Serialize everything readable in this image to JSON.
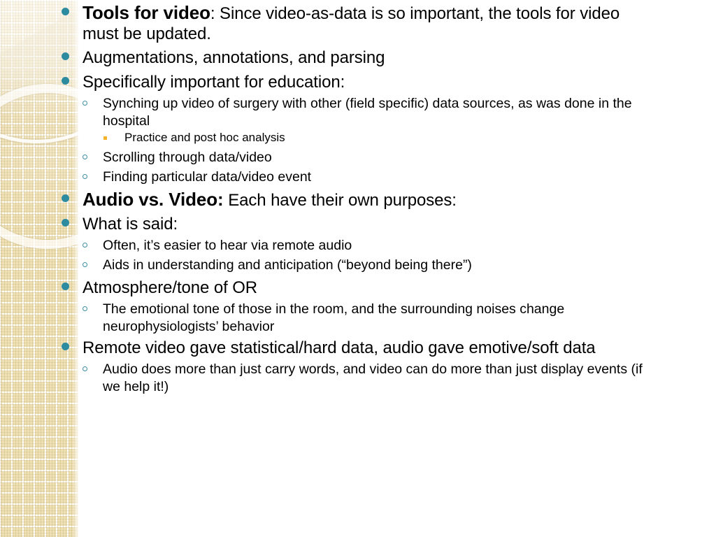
{
  "slide": {
    "background_color": "#ffffff",
    "accent_color": "#2d8ba0",
    "panel_color": "#efe3bc",
    "tertiary_bullet_color": "#f5b32a"
  },
  "decor": {
    "left_panel_name": "beige-plaid-texture-panel",
    "ring_large": "decorative-ring-large",
    "ring_small": "decorative-ring-small"
  },
  "bullets": [
    {
      "level": 1,
      "lead": "Tools for video",
      "rest": ":  Since video-as-data is so important, the tools for video must be updated.",
      "bullet_icon": "filled-circle-bullet-icon"
    },
    {
      "level": 1,
      "lead": "",
      "rest": "Augmentations, annotations, and parsing",
      "bullet_icon": "filled-circle-bullet-icon"
    },
    {
      "level": 1,
      "lead": "",
      "rest": "Specifically important for education:",
      "bullet_icon": "filled-circle-bullet-icon"
    },
    {
      "level": 2,
      "lead": "",
      "rest": "Synching up video of surgery with other (field specific) data sources, as was done in the hospital",
      "bullet_icon": "hollow-circle-bullet-icon"
    },
    {
      "level": 3,
      "lead": "",
      "rest": "Practice and post hoc analysis",
      "bullet_icon": "square-bullet-icon"
    },
    {
      "level": 2,
      "lead": "",
      "rest": "Scrolling through data/video",
      "bullet_icon": "hollow-circle-bullet-icon"
    },
    {
      "level": 2,
      "lead": "",
      "rest": "Finding particular data/video event",
      "bullet_icon": "hollow-circle-bullet-icon"
    },
    {
      "level": 1,
      "lead": "Audio vs. Video:",
      "rest": " Each have their own purposes:",
      "bullet_icon": "filled-circle-bullet-icon"
    },
    {
      "level": 1,
      "lead": "",
      "rest": "What is said:",
      "bullet_icon": "filled-circle-bullet-icon"
    },
    {
      "level": 2,
      "lead": "",
      "rest": "Often, it’s easier to hear via remote audio",
      "bullet_icon": "hollow-circle-bullet-icon"
    },
    {
      "level": 2,
      "lead": "",
      "rest": "Aids in understanding and anticipation (“beyond being there”)",
      "bullet_icon": "hollow-circle-bullet-icon"
    },
    {
      "level": 1,
      "lead": "",
      "rest": "Atmosphere/tone of OR",
      "bullet_icon": "filled-circle-bullet-icon"
    },
    {
      "level": 2,
      "lead": "",
      "rest": "The emotional tone of those in the room, and the surrounding noises change neurophysiologists’ behavior",
      "bullet_icon": "hollow-circle-bullet-icon"
    },
    {
      "level": 1,
      "lead": "",
      "rest": "Remote video gave statistical/hard data, audio gave emotive/soft data",
      "bullet_icon": "filled-circle-bullet-icon"
    },
    {
      "level": 2,
      "lead": "",
      "rest": "Audio does more than just carry words, and video can do more than just display events (if we help it!)",
      "bullet_icon": "hollow-circle-bullet-icon"
    }
  ]
}
